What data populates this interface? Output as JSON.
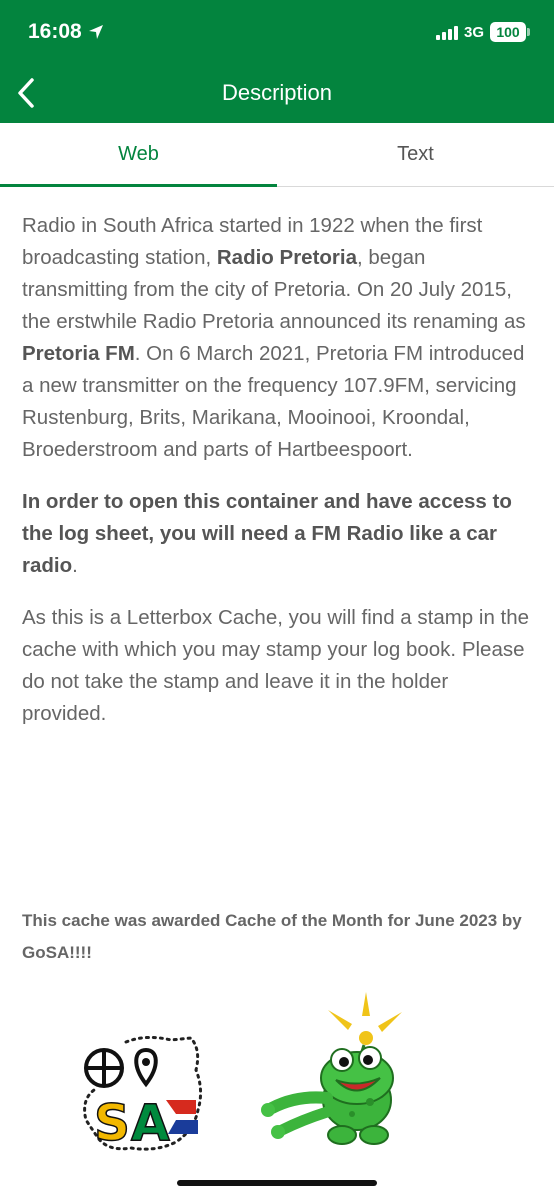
{
  "status_bar": {
    "time": "16:08",
    "network": "3G",
    "battery": "100"
  },
  "nav": {
    "title": "Description",
    "back_icon": "chevron-left-icon"
  },
  "tabs": [
    {
      "label": "Web",
      "active": true
    },
    {
      "label": "Text",
      "active": false
    }
  ],
  "description": {
    "p1": {
      "part1": "Radio in South Africa started in 1922 when the first broadcasting station, ",
      "bold1": "Radio Pretoria",
      "part2": ", began transmitting from the city of Pretoria. On 20 July 2015, the erstwhile Radio Pretoria announced its renaming as ",
      "bold2": "Pretoria FM",
      "part3": ". On 6 March 2021, Pretoria FM introduced a new transmitter on the frequency 107.9FM, servicing Rustenburg, Brits, Marikana, Mooinooi, Kroondal, Broederstroom and parts of Hartbeespoort."
    },
    "p2": {
      "bold": "In order to open this container and have access to the log sheet, you will need a FM Radio like a car radio",
      "tail": "."
    },
    "p3": "As this is a Letterbox Cache, you will find a stamp in the cache with which you may stamp your log book. Please do not take the stamp and leave it in the holder provided.",
    "award": "This cache was awarded Cache of the Month for June 2023 by GoSA!!!!"
  },
  "colors": {
    "brand_green": "#03843e",
    "text_gray": "#666666"
  },
  "images": {
    "gosa_logo": "gosa-logo",
    "frog_mascot": "frog-mascot"
  }
}
